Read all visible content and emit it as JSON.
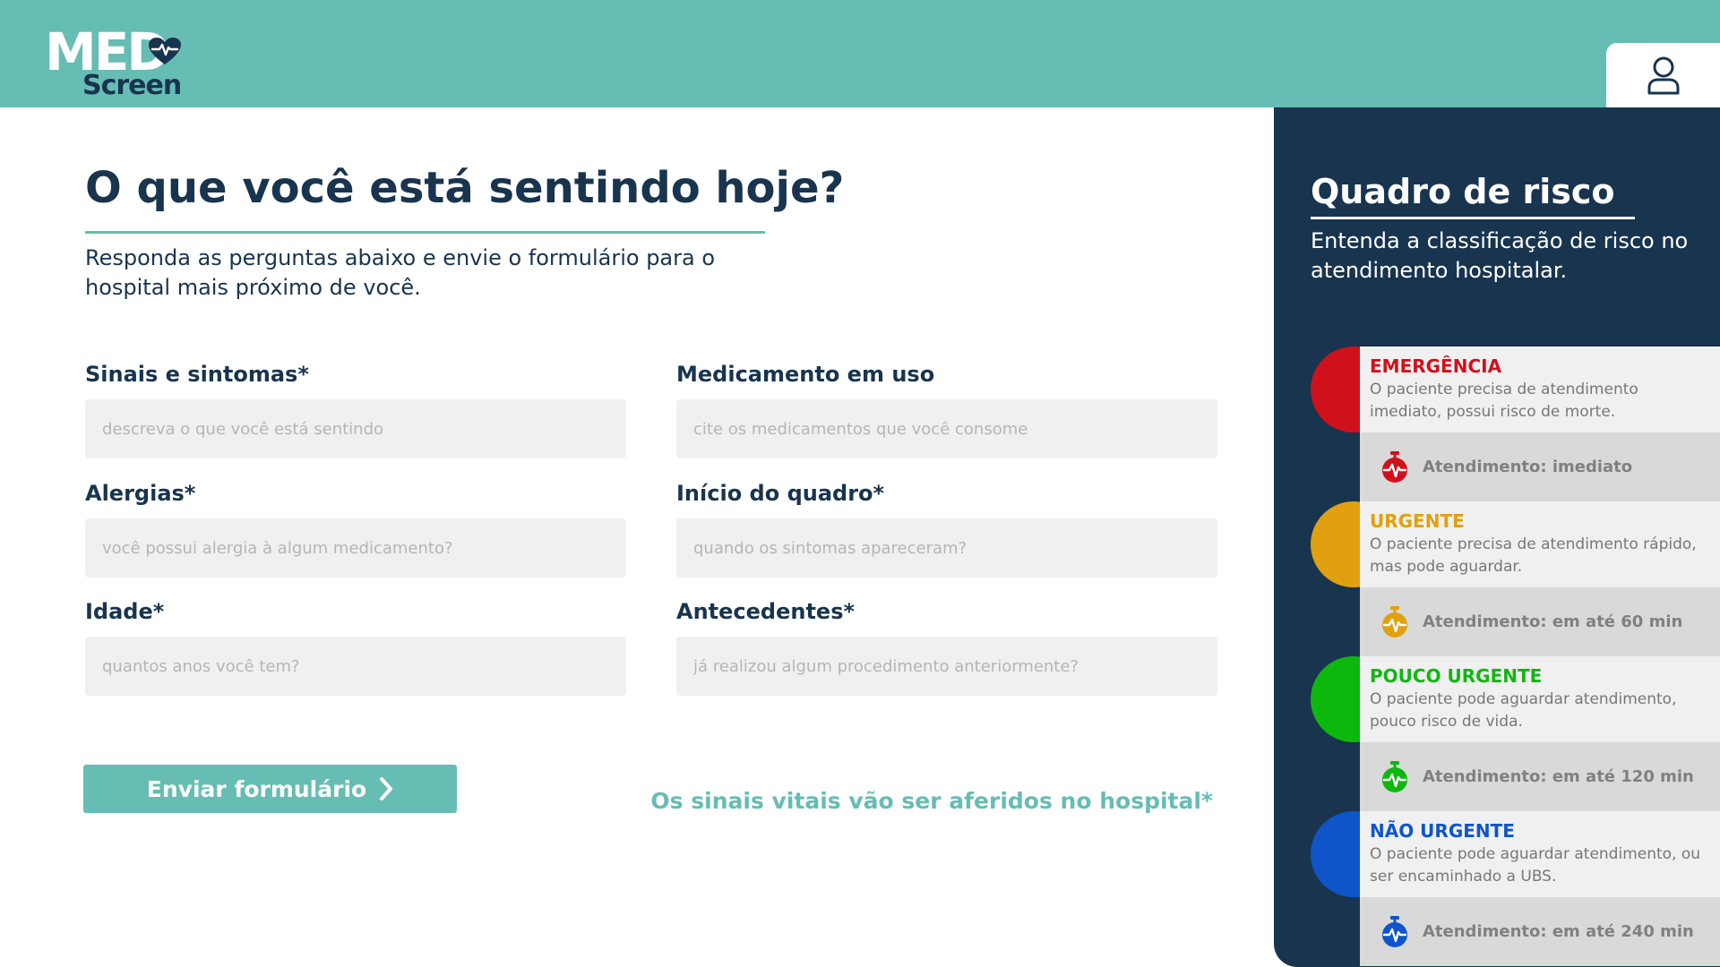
{
  "header": {
    "logo_top": "MED",
    "logo_bottom": "Screen",
    "profile_icon": "user-icon",
    "colors": {
      "header_bg": "#66bdb3",
      "navy": "#18344f"
    }
  },
  "main": {
    "title": "O que você está sentindo hoje?",
    "subtitle": "Responda as perguntas abaixo e envie o formulário para o hospital mais próximo de você.",
    "fields": [
      {
        "label": "Sinais e sintomas*",
        "placeholder": "descreva o que você está sentindo",
        "value": ""
      },
      {
        "label": "Medicamento em uso",
        "placeholder": "cite os medicamentos que você consome",
        "value": ""
      },
      {
        "label": "Alergias*",
        "placeholder": "você possui alergia à algum medicamento?",
        "value": ""
      },
      {
        "label": "Início do quadro*",
        "placeholder": "quando os sintomas apareceram?",
        "value": ""
      },
      {
        "label": "Idade*",
        "placeholder": "quantos anos você tem?",
        "value": ""
      },
      {
        "label": "Antecedentes*",
        "placeholder": "já realizou algum procedimento anteriormente?",
        "value": ""
      }
    ],
    "submit_label": "Enviar formulário",
    "submit_icon": "chevron-right-icon",
    "note": "Os sinais vitais vão ser aferidos no hospital*"
  },
  "sidebar": {
    "title": "Quadro de risco",
    "subtitle": "Entenda a classificação de risco no atendimento hospitalar.",
    "levels": [
      {
        "name": "EMERGÊNCIA",
        "description": "O paciente precisa de atendimento imediato, possui risco de morte.",
        "time": "Atendimento: imediato",
        "color": "#d0111b",
        "icon": "stopwatch-icon"
      },
      {
        "name": "URGENTE",
        "description": "O paciente precisa de atendimento rápido, mas pode aguardar.",
        "time": "Atendimento: em até 60 min",
        "color": "#e0a00f",
        "icon": "stopwatch-icon"
      },
      {
        "name": "POUCO URGENTE",
        "description": "O paciente pode aguardar atendimento, pouco risco de vida.",
        "time": "Atendimento: em até 120 min",
        "color": "#0db80d",
        "icon": "stopwatch-icon"
      },
      {
        "name": "NÃO URGENTE",
        "description": "O paciente pode aguardar atendimento, ou ser encaminhado a UBS.",
        "time": "Atendimento: em até 240 min",
        "color": "#0f55c9",
        "icon": "stopwatch-icon"
      }
    ]
  }
}
